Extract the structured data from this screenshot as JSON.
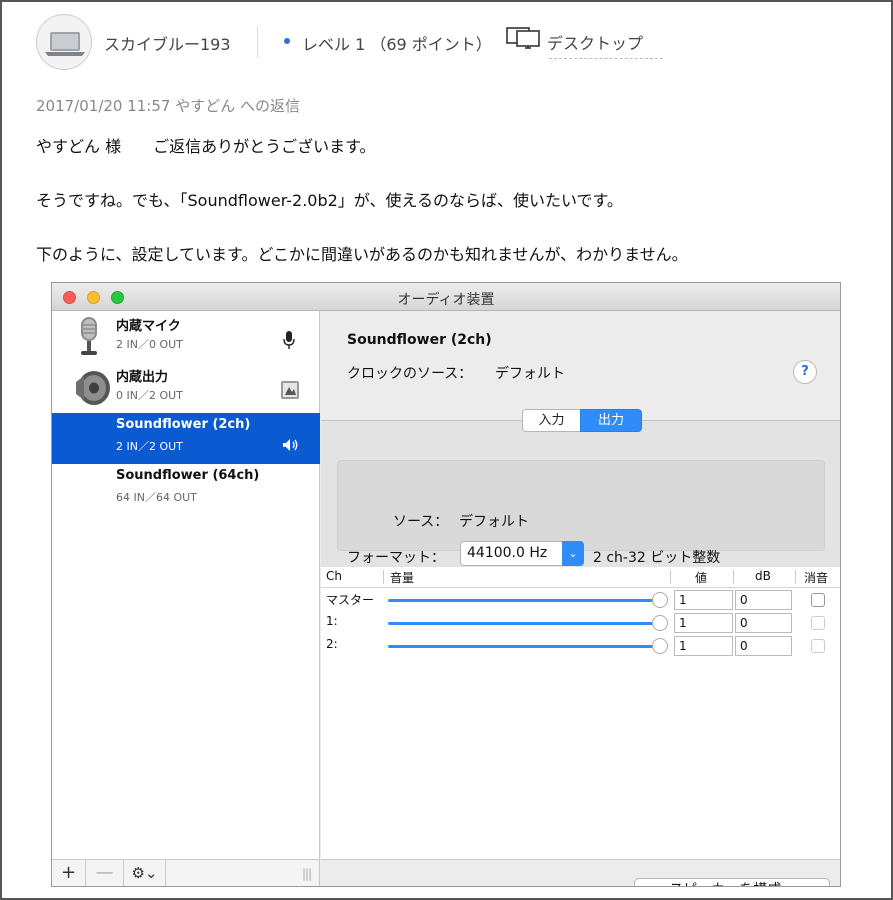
{
  "post": {
    "user_name": "スカイブルー193",
    "level_text": "レベル 1 （69 ポイント）",
    "device_text": "デスクトップ",
    "reply_meta": "2017/01/20 11:57 やすどん への返信",
    "paragraphs": [
      "やすどん 様　　ご返信ありがとうございます。",
      "そうですね。でも、「Soundflower-2.0b2」が、使えるのならば、使いたいです。",
      "下のように、設定しています。どこかに間違いがあるのかも知れませんが、わかりません。"
    ]
  },
  "window": {
    "title": "オーディオ装置",
    "devices": [
      {
        "name": "内蔵マイク",
        "io": "2 IN／0 OUT",
        "icon": "microphone-icon"
      },
      {
        "name": "内蔵出力",
        "io": "0 IN／2 OUT",
        "icon": "speaker-icon"
      },
      {
        "name": "Soundflower (2ch)",
        "io": "2 IN／2 OUT",
        "selected": true
      },
      {
        "name": "Soundflower (64ch)",
        "io": "64 IN／64 OUT"
      }
    ],
    "bottom_bar": {
      "add": "+",
      "remove": "—",
      "gear": "⚙⌄"
    },
    "detail": {
      "title": "Soundflower (2ch)",
      "clock_label": "クロックのソース：",
      "clock_value": "デフォルト",
      "help": "?",
      "tabs": [
        "入力",
        "出力"
      ],
      "active_tab": "出力",
      "source_label": "ソース：",
      "source_value": "デフォルト",
      "format_label": "フォーマット：",
      "format_select": "44100.0 Hz",
      "format_value": "2 ch-32 ビット整数",
      "table": {
        "headers": {
          "ch": "Ch",
          "volume": "音量",
          "value": "値",
          "db": "dB",
          "mute": "消音"
        },
        "rows": [
          {
            "ch": "マスター",
            "value": "1",
            "db": "0",
            "volume_level": 1.0
          },
          {
            "ch": "1:",
            "value": "1",
            "db": "0",
            "volume_level": 1.0
          },
          {
            "ch": "2:",
            "value": "1",
            "db": "0",
            "volume_level": 1.0
          }
        ]
      },
      "speaker_button": "スピーカーを構成..."
    }
  },
  "colors": {
    "selection": "#0a5ad2",
    "accent": "#2f8cf8",
    "level_dot": "#2a6fdb"
  }
}
